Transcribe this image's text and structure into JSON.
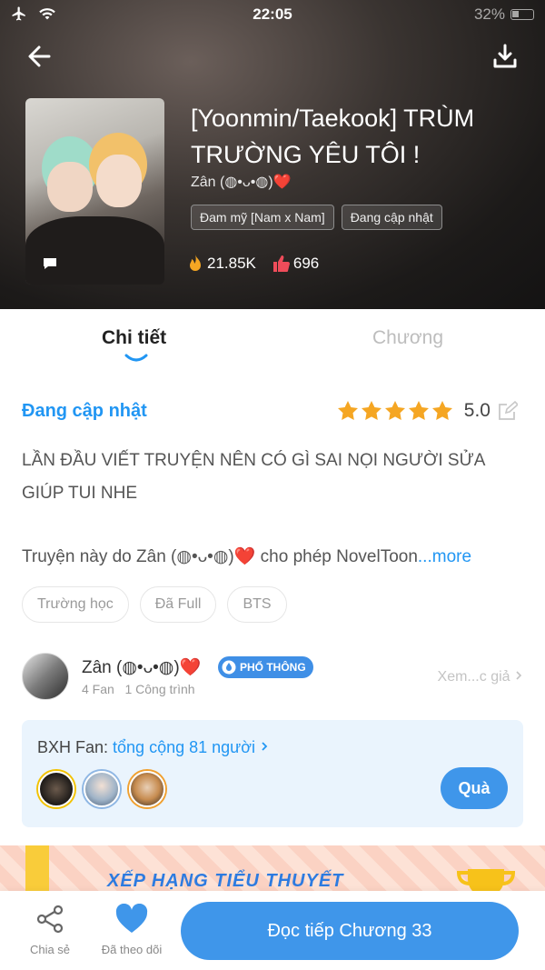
{
  "status_bar": {
    "time": "22:05",
    "battery": "32%"
  },
  "book": {
    "title": "[Yoonmin/Taekook] TRÙM TRƯỜNG YÊU TÔI !",
    "author": "Zân (◍•ᴗ•◍)❤️",
    "tags": [
      "Đam mỹ [Nam x Nam]",
      "Đang cập nhật"
    ],
    "views": "21.85K",
    "likes": "696"
  },
  "tabs": {
    "detail": "Chi tiết",
    "chapters": "Chương"
  },
  "detail": {
    "status": "Đang cập nhật",
    "rating": "5.0",
    "rating_stars": 5,
    "description": "LẦN ĐẦU VIẾT TRUYỆN NÊN CÓ GÌ SAI NỌI NGƯỜI SỬA GIÚP TUI NHE",
    "permission": "Truyện này do Zân (◍•ᴗ•◍)❤️ cho phép NovelToon",
    "more": "...more",
    "genres": [
      "Trường học",
      "Đã Full",
      "BTS"
    ]
  },
  "author_card": {
    "name": "Zân (◍•ᴗ•◍)❤️",
    "badge": "PHỔ THÔNG",
    "fans": "4 Fan",
    "works": "1 Công trình",
    "view_link": "Xem...c giả"
  },
  "fan_rank": {
    "label": "BXH Fan: ",
    "total": "tổng cộng 81 người",
    "gift_button": "Quà"
  },
  "banner": {
    "text": "XẾP HẠNG TIỂU THUYẾT"
  },
  "bottom": {
    "share": "Chia sẻ",
    "follow": "Đã theo dõi",
    "read": "Đọc tiếp Chương 33"
  },
  "colors": {
    "accent": "#2196f3",
    "button": "#3f96ea",
    "star": "#f5a623"
  },
  "icons": [
    "airplane-icon",
    "wifi-icon",
    "battery-icon",
    "back-arrow-icon",
    "download-icon",
    "comment-icon",
    "flame-icon",
    "thumbs-up-icon",
    "star-icon",
    "edit-icon",
    "chevron-right-icon",
    "share-icon",
    "heart-icon",
    "trophy-icon"
  ]
}
